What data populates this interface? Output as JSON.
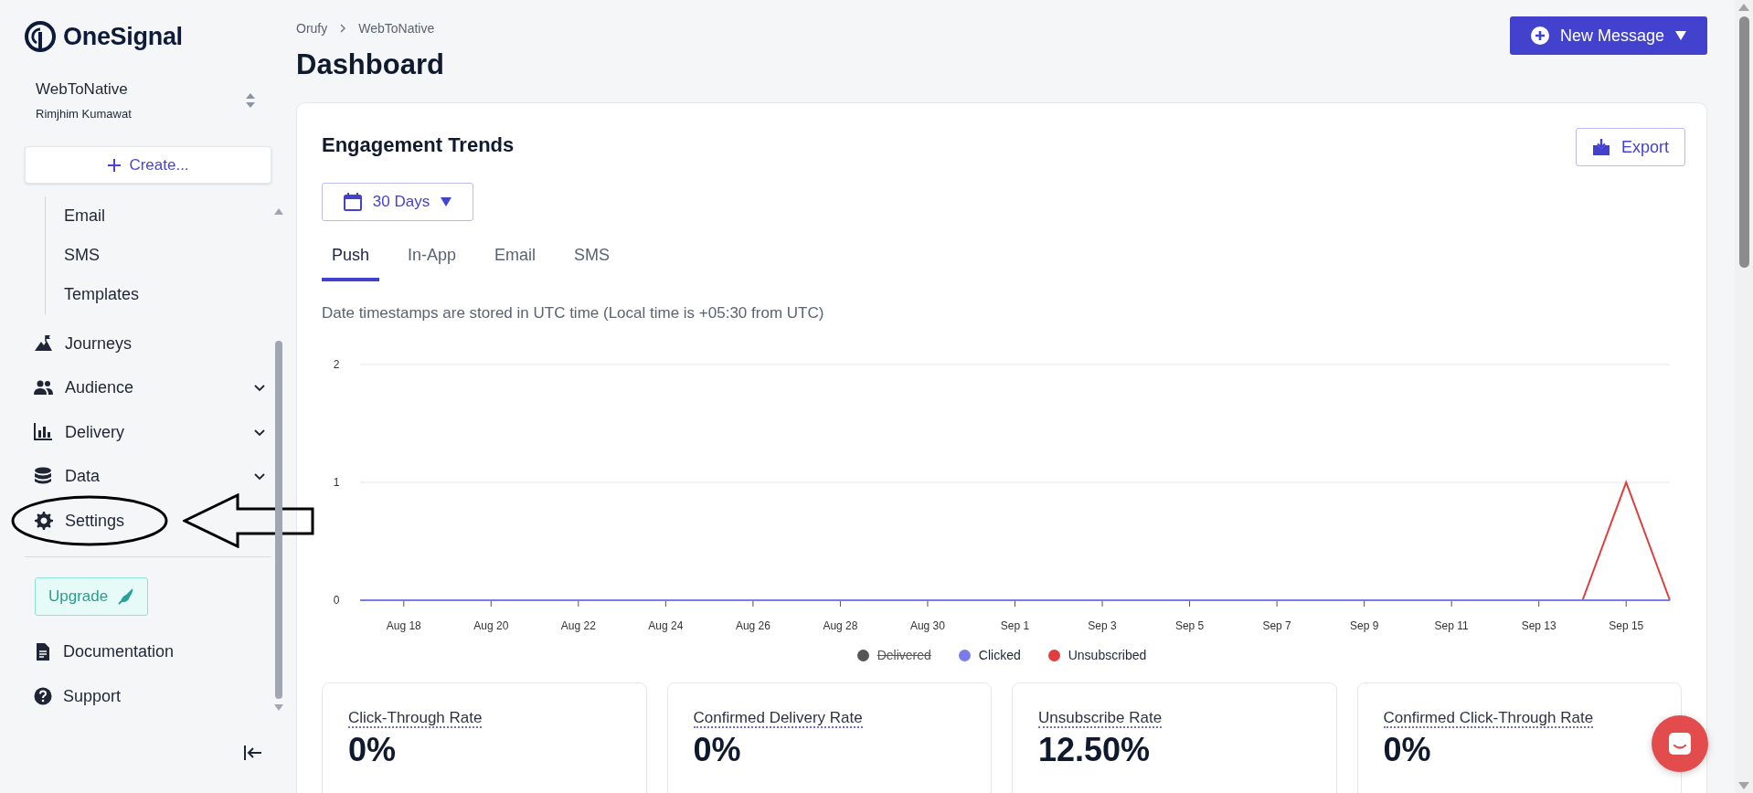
{
  "sidebar": {
    "logo": "OneSignal",
    "org": {
      "name": "WebToNative",
      "user": "Rimjhim Kumawat"
    },
    "create_button": "Create...",
    "nav_items": [
      {
        "label": "Email",
        "kind": "subitem",
        "circled": false
      },
      {
        "label": "SMS",
        "kind": "subitem",
        "circled": false
      },
      {
        "label": "Templates",
        "kind": "subitem",
        "circled": false
      },
      {
        "label": "Journeys",
        "kind": "item",
        "circled": false
      },
      {
        "label": "Audience",
        "kind": "item",
        "expanded": false,
        "circled": false
      },
      {
        "label": "Delivery",
        "kind": "item",
        "expanded": false,
        "circled": false
      },
      {
        "label": "Data",
        "kind": "item",
        "expanded": false,
        "circled": false
      },
      {
        "label": "Settings",
        "kind": "item",
        "circled": true
      }
    ],
    "upgrade_button": "Upgrade",
    "footer_links": [
      "Documentation",
      "Support"
    ]
  },
  "header": {
    "breadcrumb": [
      "Orufy",
      "WebToNative"
    ],
    "title": "Dashboard",
    "new_message_button": "New Message"
  },
  "engagement": {
    "title": "Engagement Trends",
    "export_button": "Export",
    "range": "30 Days",
    "tabs": [
      {
        "label": "Push",
        "selected": true
      },
      {
        "label": "In-App",
        "selected": false
      },
      {
        "label": "Email",
        "selected": false
      },
      {
        "label": "SMS",
        "selected": false
      }
    ],
    "note": "Date timestamps are stored in UTC time (Local time is +05:30 from UTC)",
    "chart_data": {
      "type": "line",
      "categories": [
        null,
        "Aug 18",
        null,
        "Aug 20",
        null,
        "Aug 22",
        null,
        "Aug 24",
        null,
        "Aug 26",
        null,
        "Aug 28",
        null,
        "Aug 30",
        null,
        "Sep 1",
        null,
        "Sep 3",
        null,
        "Sep 5",
        null,
        "Sep 7",
        null,
        "Sep 9",
        null,
        "Sep 11",
        null,
        "Sep 13",
        null,
        "Sep 15",
        null
      ],
      "ylim": [
        0,
        2
      ],
      "yticks": [
        0,
        1,
        2
      ],
      "series": [
        {
          "name": "Clicked",
          "color": "#7b7bea",
          "values": [
            0,
            0,
            0,
            0,
            0,
            0,
            0,
            0,
            0,
            0,
            0,
            0,
            0,
            0,
            0,
            0,
            0,
            0,
            0,
            0,
            0,
            0,
            0,
            0,
            0,
            0,
            0,
            0,
            0,
            0,
            0
          ]
        },
        {
          "name": "Unsubscribed",
          "color": "#e03e3e",
          "values": [
            null,
            null,
            null,
            null,
            null,
            null,
            null,
            null,
            null,
            null,
            null,
            null,
            null,
            null,
            null,
            null,
            null,
            null,
            null,
            null,
            null,
            null,
            null,
            null,
            null,
            null,
            null,
            null,
            0,
            1,
            0
          ]
        }
      ]
    },
    "hidden_series": [
      {
        "label": "Delivered",
        "color": "#555555",
        "hidden": true
      }
    ],
    "stats": [
      {
        "label": "Click-Through Rate",
        "value": "0%"
      },
      {
        "label": "Confirmed Delivery Rate",
        "value": "0%"
      },
      {
        "label": "Unsubscribe Rate",
        "value": "12.50%"
      },
      {
        "label": "Confirmed Click-Through Rate",
        "value": "0%"
      }
    ]
  }
}
